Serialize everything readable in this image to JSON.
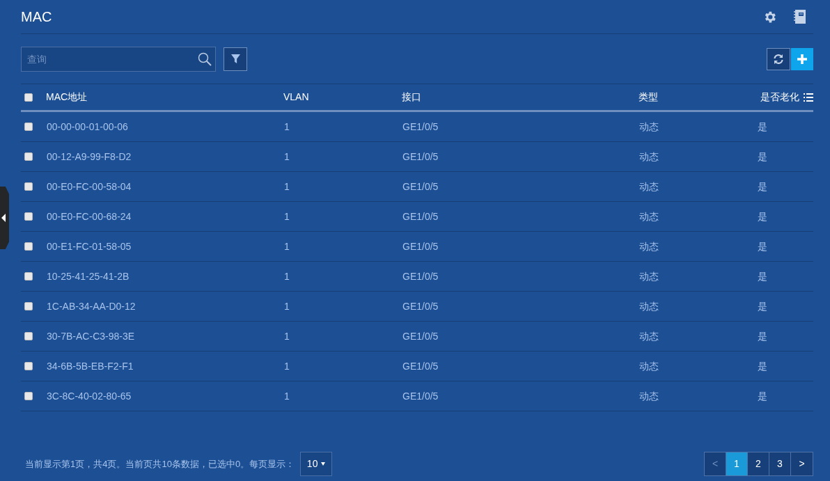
{
  "header": {
    "title": "MAC"
  },
  "search": {
    "placeholder": "查询"
  },
  "table": {
    "header_checked": false,
    "columns": [
      "MAC地址",
      "VLAN",
      "接口",
      "类型",
      "是否老化"
    ],
    "rows": [
      {
        "checked": false,
        "cells": [
          "00-00-00-01-00-06",
          "1",
          "GE1/0/5",
          "动态",
          "是"
        ]
      },
      {
        "checked": false,
        "cells": [
          "00-12-A9-99-F8-D2",
          "1",
          "GE1/0/5",
          "动态",
          "是"
        ]
      },
      {
        "checked": false,
        "cells": [
          "00-E0-FC-00-58-04",
          "1",
          "GE1/0/5",
          "动态",
          "是"
        ]
      },
      {
        "checked": false,
        "cells": [
          "00-E0-FC-00-68-24",
          "1",
          "GE1/0/5",
          "动态",
          "是"
        ]
      },
      {
        "checked": false,
        "cells": [
          "00-E1-FC-01-58-05",
          "1",
          "GE1/0/5",
          "动态",
          "是"
        ]
      },
      {
        "checked": false,
        "cells": [
          "10-25-41-25-41-2B",
          "1",
          "GE1/0/5",
          "动态",
          "是"
        ]
      },
      {
        "checked": false,
        "cells": [
          "1C-AB-34-AA-D0-12",
          "1",
          "GE1/0/5",
          "动态",
          "是"
        ]
      },
      {
        "checked": false,
        "cells": [
          "30-7B-AC-C3-98-3E",
          "1",
          "GE1/0/5",
          "动态",
          "是"
        ]
      },
      {
        "checked": false,
        "cells": [
          "34-6B-5B-EB-F2-F1",
          "1",
          "GE1/0/5",
          "动态",
          "是"
        ]
      },
      {
        "checked": false,
        "cells": [
          "3C-8C-40-02-80-65",
          "1",
          "GE1/0/5",
          "动态",
          "是"
        ]
      }
    ]
  },
  "footer": {
    "summary": "当前显示第1页，共4页。当前页共10条数据，已选中0。每页显示：",
    "page_size": "10"
  },
  "pagination": {
    "prev": {
      "label": "<",
      "disabled": true
    },
    "pages": [
      {
        "label": "1",
        "selected": true
      },
      {
        "label": "2",
        "selected": false
      },
      {
        "label": "3",
        "selected": false
      }
    ],
    "next": {
      "label": ">",
      "disabled": false
    }
  }
}
